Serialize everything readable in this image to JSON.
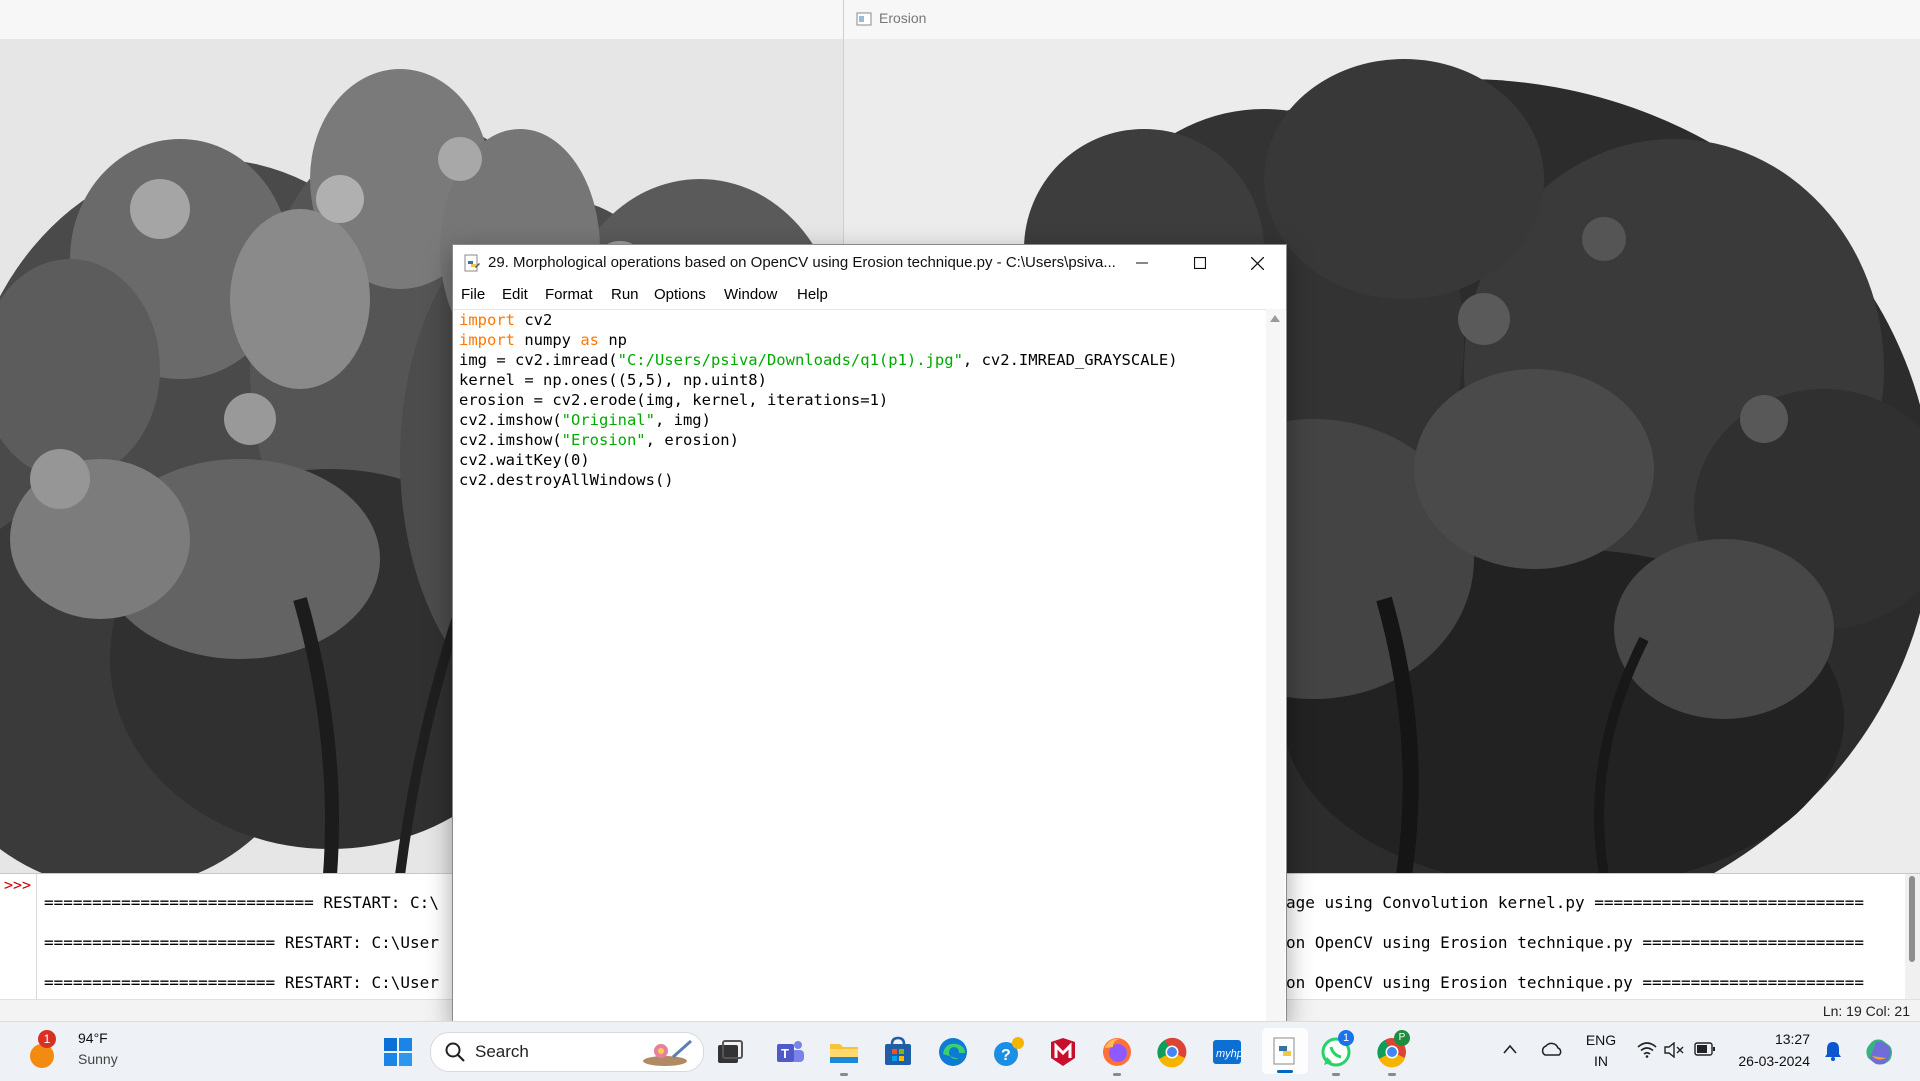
{
  "erosion_window": {
    "title": "Erosion"
  },
  "editor": {
    "title": "29. Morphological operations based on OpenCV using Erosion technique.py - C:\\Users\\psiva...",
    "menu": [
      "File",
      "Edit",
      "Format",
      "Run",
      "Options",
      "Window",
      "Help"
    ],
    "code_lines": [
      [
        {
          "t": "import",
          "c": "kw"
        },
        {
          "t": " cv2",
          "c": ""
        }
      ],
      [
        {
          "t": "import",
          "c": "kw"
        },
        {
          "t": " numpy ",
          "c": ""
        },
        {
          "t": "as",
          "c": "kw"
        },
        {
          "t": " np",
          "c": ""
        }
      ],
      [
        {
          "t": "img = cv2.imread(",
          "c": ""
        },
        {
          "t": "\"C:/Users/psiva/Downloads/q1(p1).jpg\"",
          "c": "str"
        },
        {
          "t": ", cv2.IMREAD_GRAYSCALE)",
          "c": ""
        }
      ],
      [
        {
          "t": "kernel = np.ones((5,5), np.uint8)",
          "c": ""
        }
      ],
      [
        {
          "t": "erosion = cv2.erode(img, kernel, iterations=1)",
          "c": ""
        }
      ],
      [
        {
          "t": "cv2.imshow(",
          "c": ""
        },
        {
          "t": "\"Original\"",
          "c": "str"
        },
        {
          "t": ", img)",
          "c": ""
        }
      ],
      [
        {
          "t": "cv2.imshow(",
          "c": ""
        },
        {
          "t": "\"Erosion\"",
          "c": "str"
        },
        {
          "t": ", erosion)",
          "c": ""
        }
      ],
      [
        {
          "t": "cv2.waitKey(0)",
          "c": ""
        }
      ],
      [
        {
          "t": "cv2.destroyAllWindows()",
          "c": ""
        }
      ]
    ]
  },
  "shell": {
    "prompt": ">>>",
    "lines_left": [
      "============================ RESTART: C:\\",
      "======================== RESTART: C:\\User",
      "======================== RESTART: C:\\User"
    ],
    "lines_right": [
      "age using Convolution kernel.py ============================",
      "on OpenCV using Erosion technique.py =======================",
      "on OpenCV using Erosion technique.py ======================="
    ],
    "status": "Ln: 19   Col: 21"
  },
  "taskbar": {
    "weather": {
      "temp": "94°F",
      "condition": "Sunny",
      "badge": "1"
    },
    "search_label": "Search",
    "apps": [
      "windows-start",
      "search",
      "task-view",
      "teams",
      "file-explorer",
      "microsoft-store",
      "edge",
      "get-help",
      "mcafee",
      "firefox",
      "chrome",
      "myhp",
      "python-idle",
      "whatsapp",
      "chrome-profile"
    ],
    "whatsapp_badge": "1",
    "chrome_profile_badge": "P",
    "tray": {
      "lang_top": "ENG",
      "lang_bottom": "IN",
      "time": "13:27",
      "date": "26-03-2024"
    }
  },
  "colors": {
    "keyword": "#ff7700",
    "string": "#00aa00",
    "shell_prompt": "#cc0000",
    "taskbar_bg": "#eef1f6"
  }
}
